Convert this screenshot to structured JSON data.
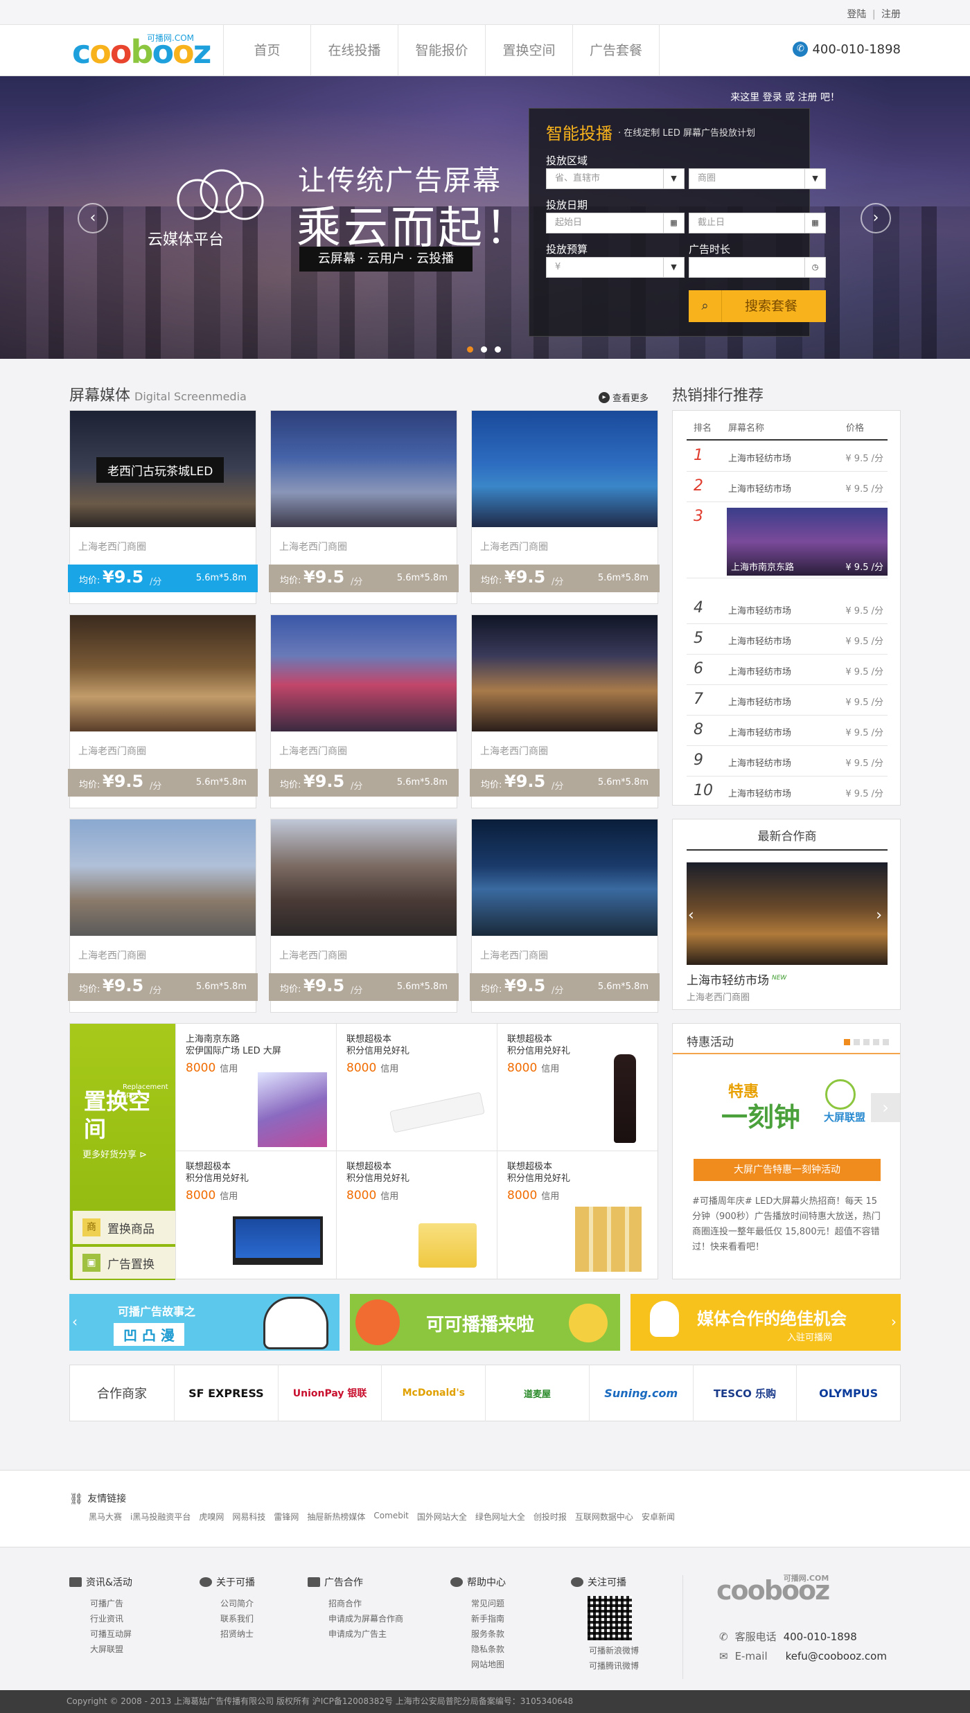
{
  "topbar": {
    "login": "登陆",
    "sep": "|",
    "register": "注册"
  },
  "header": {
    "logo_text": "coobooz",
    "logo_sub": "可播网.COM",
    "nav": [
      "首页",
      "在线投播",
      "智能报价",
      "置换空间",
      "广告套餐"
    ],
    "phone": "400-010-1898"
  },
  "banner": {
    "brand": "云媒体平台",
    "headline1": "让传统广告屏幕",
    "headline2": "乘云而起！",
    "tagline": "云屏幕 · 云用户 · 云投播",
    "login_hint": "来这里 登录 或 注册 吧！",
    "panel": {
      "title": "智能投播",
      "subtitle": "· 在线定制 LED 屏幕广告投放计划",
      "area_label": "投放区域",
      "area_placeholder": "省、直辖市",
      "district_placeholder": "商圈",
      "date_label": "投放日期",
      "start_placeholder": "起始日",
      "end_placeholder": "截止日",
      "budget_label": "投放预算",
      "budget_placeholder": "¥",
      "duration_label": "广告时长",
      "search_button": "搜索套餐"
    }
  },
  "screens": {
    "title": "屏幕媒体",
    "title_en": "Digital Screenmedia",
    "more": "查看更多",
    "cards": [
      {
        "badge": "老西门古玩茶城LED",
        "loc": "上海老西门商圈",
        "price_label": "均价:",
        "price": "¥9.5",
        "unit": "/分",
        "size": "5.6m*5.8m",
        "highlight": true
      },
      {
        "loc": "上海老西门商圈",
        "price_label": "均价:",
        "price": "¥9.5",
        "unit": "/分",
        "size": "5.6m*5.8m"
      },
      {
        "loc": "上海老西门商圈",
        "price_label": "均价:",
        "price": "¥9.5",
        "unit": "/分",
        "size": "5.6m*5.8m"
      },
      {
        "loc": "上海老西门商圈",
        "price_label": "均价:",
        "price": "¥9.5",
        "unit": "/分",
        "size": "5.6m*5.8m"
      },
      {
        "loc": "上海老西门商圈",
        "price_label": "均价:",
        "price": "¥9.5",
        "unit": "/分",
        "size": "5.6m*5.8m"
      },
      {
        "loc": "上海老西门商圈",
        "price_label": "均价:",
        "price": "¥9.5",
        "unit": "/分",
        "size": "5.6m*5.8m"
      },
      {
        "loc": "上海老西门商圈",
        "price_label": "均价:",
        "price": "¥9.5",
        "unit": "/分",
        "size": "5.6m*5.8m"
      },
      {
        "loc": "上海老西门商圈",
        "price_label": "均价:",
        "price": "¥9.5",
        "unit": "/分",
        "size": "5.6m*5.8m"
      },
      {
        "loc": "上海老西门商圈",
        "price_label": "均价:",
        "price": "¥9.5",
        "unit": "/分",
        "size": "5.6m*5.8m"
      }
    ]
  },
  "ranking": {
    "title": "热销排行推荐",
    "col_rank": "排名",
    "col_name": "屏幕名称",
    "col_price": "价格",
    "rows": [
      {
        "n": "1",
        "name": "上海市轻纺市场",
        "price": "¥ 9.5 /分"
      },
      {
        "n": "2",
        "name": "上海市轻纺市场",
        "price": "¥ 9.5 /分"
      },
      {
        "n": "3",
        "name": "上海市南京东路",
        "price": "¥ 9.5 /分"
      },
      {
        "n": "4",
        "name": "上海市轻纺市场",
        "price": "¥ 9.5 /分"
      },
      {
        "n": "5",
        "name": "上海市轻纺市场",
        "price": "¥ 9.5 /分"
      },
      {
        "n": "6",
        "name": "上海市轻纺市场",
        "price": "¥ 9.5 /分"
      },
      {
        "n": "7",
        "name": "上海市轻纺市场",
        "price": "¥ 9.5 /分"
      },
      {
        "n": "8",
        "name": "上海市轻纺市场",
        "price": "¥ 9.5 /分"
      },
      {
        "n": "9",
        "name": "上海市轻纺市场",
        "price": "¥ 9.5 /分"
      },
      {
        "n": "10",
        "name": "上海市轻纺市场",
        "price": "¥ 9.5 /分"
      }
    ]
  },
  "partner": {
    "title": "最新合作商",
    "name": "上海市轻纺市场",
    "badge": "NEW",
    "loc": "上海老西门商圈"
  },
  "promo": {
    "title": "特惠活动",
    "img_title": "特惠",
    "img_sub": "一刻钟",
    "img_tag": "大屏联盟",
    "button": "大屏广告特惠一刻钟活动",
    "desc": "#可播周年庆# LED大屏幕火热招商！每天 15 分钟（900秒）广告播放时间特惠大放送，热门商圈连投一整年最低仅 15,800元！超值不容错过！快来看看吧！"
  },
  "exchange": {
    "title": "置换空间",
    "title_en": "Replacement space",
    "more": "更多好货分享",
    "tab1": "置换商品",
    "tab2": "广告置换",
    "items": [
      {
        "t1": "上海南京东路",
        "t2": "宏伊国际广场 LED 大屏",
        "pts": "8000",
        "unit": "信用"
      },
      {
        "t1": "联想超极本",
        "t2": "积分信用兑好礼",
        "pts": "8000",
        "unit": "信用"
      },
      {
        "t1": "联想超极本",
        "t2": "积分信用兑好礼",
        "pts": "8000",
        "unit": "信用"
      },
      {
        "t1": "联想超极本",
        "t2": "积分信用兑好礼",
        "pts": "8000",
        "unit": "信用"
      },
      {
        "t1": "联想超极本",
        "t2": "积分信用兑好礼",
        "pts": "8000",
        "unit": "信用"
      },
      {
        "t1": "联想超极本",
        "t2": "积分信用兑好礼",
        "pts": "8000",
        "unit": "信用"
      }
    ]
  },
  "promos": {
    "b1_line1": "可播广告故事之",
    "b1_line2": "凹 凸 漫",
    "b2": "可可播播来啦",
    "b3": "媒体合作的绝佳机会",
    "b3_sub": "入驻可播网"
  },
  "partners": {
    "label": "合作商家",
    "brands": [
      "SF EXPRESS",
      "UnionPay 银联",
      "McDonald's",
      "道麦屋",
      "Suning.com",
      "TESCO 乐购",
      "OLYMPUS"
    ]
  },
  "friend_links": {
    "title": "友情链接",
    "links": [
      "黑马大赛",
      "i黑马投融资平台",
      "虎嗅网",
      "网易科技",
      "雷锋网",
      "抽屉新热榜媒体",
      "Comebit",
      "国外网站大全",
      "绿色网址大全",
      "创投时报",
      "互联网数据中心",
      "安卓新闻"
    ]
  },
  "footer": {
    "cols": [
      {
        "title": "资讯&活动",
        "links": [
          "可播广告",
          "行业资讯",
          "可播互动屏",
          "大屏联盟"
        ]
      },
      {
        "title": "关于可播",
        "links": [
          "公司简介",
          "联系我们",
          "招贤纳士"
        ]
      },
      {
        "title": "广告合作",
        "links": [
          "招商合作",
          "申请成为屏幕合作商",
          "申请成为广告主"
        ]
      },
      {
        "title": "帮助中心",
        "links": [
          "常见问题",
          "新手指南",
          "服务条款",
          "隐私条款",
          "网站地图"
        ]
      },
      {
        "title": "关注可播",
        "links": [
          "可播新浪微博",
          "可播腾讯微博"
        ]
      }
    ],
    "logo": "coobooz",
    "logo_sub": "可播网.COM",
    "phone_label": "客服电话",
    "phone": "400-010-1898",
    "email_label": "E-mail",
    "email": "kefu@coobooz.com"
  },
  "copyright": "Copyright © 2008 - 2013   上海葛姑广告传播有限公司  版权所有   沪ICP备12008382号      上海市公安局普陀分局备案编号：3105340648"
}
